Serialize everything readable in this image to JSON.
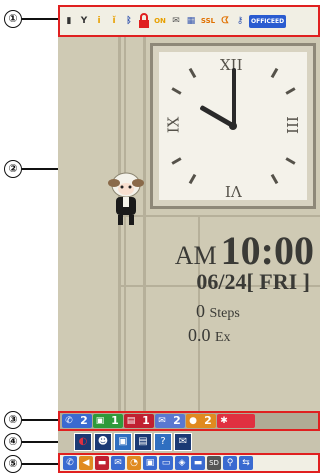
{
  "callouts": [
    "①",
    "②",
    "③",
    "④",
    "⑤"
  ],
  "status_bar": {
    "icons": [
      {
        "name": "battery-icon",
        "glyph": "▮",
        "color": "#333333"
      },
      {
        "name": "signal-icon",
        "glyph": "Y",
        "color": "#333333"
      },
      {
        "name": "antenna-icon",
        "glyph": "i",
        "color": "#e8a000"
      },
      {
        "name": "gps-icon",
        "glyph": "ǐ",
        "color": "#e8a000"
      },
      {
        "name": "bluetooth-icon",
        "glyph": "ᛒ",
        "color": "#3a5ab0"
      },
      {
        "name": "lock-icon",
        "glyph": "🔒",
        "color": "#e02020"
      },
      {
        "name": "keypad-lock-icon",
        "glyph": "ON",
        "color": "#e8a000"
      },
      {
        "name": "mail-icon",
        "glyph": "✉",
        "color": "#555555"
      },
      {
        "name": "calendar-icon",
        "glyph": "▦",
        "color": "#3a5ab0"
      },
      {
        "name": "ssl-icon",
        "glyph": "SSL",
        "color": "#e07000"
      },
      {
        "name": "music-icon",
        "glyph": "ᗧ",
        "color": "#e07000"
      },
      {
        "name": "key-icon",
        "glyph": "⚷",
        "color": "#3a5ab0"
      }
    ],
    "officeed": "OFFICEED"
  },
  "clock": {
    "numerals": {
      "xii": "XII",
      "ix": "IX",
      "iii": "III",
      "vi": "VI"
    }
  },
  "time": {
    "ampm": "AM",
    "hm": "10:00",
    "date": "06/24[ FRI ]"
  },
  "pedometer": {
    "steps_value": "0",
    "steps_unit": "Steps",
    "ex_value": "0.0",
    "ex_unit": "Ex"
  },
  "notif_bar": {
    "items": [
      {
        "name": "missed-call",
        "glyph": "✆",
        "count": "2",
        "color": "#3a6ad0"
      },
      {
        "name": "new-sms",
        "glyph": "▣",
        "count": "1",
        "color": "#2e9a3a"
      },
      {
        "name": "new-mail",
        "glyph": "▤",
        "count": "1",
        "color": "#c02030"
      },
      {
        "name": "new-message",
        "glyph": "✉",
        "count": "2",
        "color": "#5a78d0"
      },
      {
        "name": "voicemail",
        "glyph": "●",
        "count": "2",
        "color": "#e08a20"
      },
      {
        "name": "alarm",
        "glyph": "✱",
        "count": "",
        "color": "#e03040"
      }
    ]
  },
  "shortcuts": [
    {
      "name": "shortcut-camera-icon",
      "glyph": "◐",
      "color": "#c02030"
    },
    {
      "name": "shortcut-person-icon",
      "glyph": "☻",
      "color": "#ffffff"
    },
    {
      "name": "shortcut-app-icon",
      "glyph": "▣",
      "color": "#ffffff"
    },
    {
      "name": "shortcut-document-icon",
      "glyph": "▤",
      "color": "#ffffff"
    },
    {
      "name": "shortcut-help-icon",
      "glyph": "?",
      "color": "#ffffff"
    },
    {
      "name": "shortcut-mail-icon",
      "glyph": "✉",
      "color": "#ffffff"
    }
  ],
  "bottom_icons": [
    {
      "name": "phone-icon",
      "glyph": "✆",
      "color": "#3a6ad0"
    },
    {
      "name": "speaker-icon",
      "glyph": "◀",
      "color": "#e08a20"
    },
    {
      "name": "car-icon",
      "glyph": "▬",
      "color": "#c02030"
    },
    {
      "name": "mail-box-icon",
      "glyph": "✉",
      "color": "#3a6ad0"
    },
    {
      "name": "timer-icon",
      "glyph": "◔",
      "color": "#e08a20"
    },
    {
      "name": "image-icon",
      "glyph": "▣",
      "color": "#3a6ad0"
    },
    {
      "name": "tv-icon",
      "glyph": "▭",
      "color": "#3a6ad0"
    },
    {
      "name": "infrared-icon",
      "glyph": "◈",
      "color": "#3a6ad0"
    },
    {
      "name": "pc-icon",
      "glyph": "▬",
      "color": "#3a6ad0"
    },
    {
      "name": "sd-card-icon",
      "glyph": "SD",
      "color": "#555555"
    },
    {
      "name": "usb-icon",
      "glyph": "⚲",
      "color": "#3a6ad0"
    },
    {
      "name": "transfer-icon",
      "glyph": "⇆",
      "color": "#3a6ad0"
    }
  ]
}
